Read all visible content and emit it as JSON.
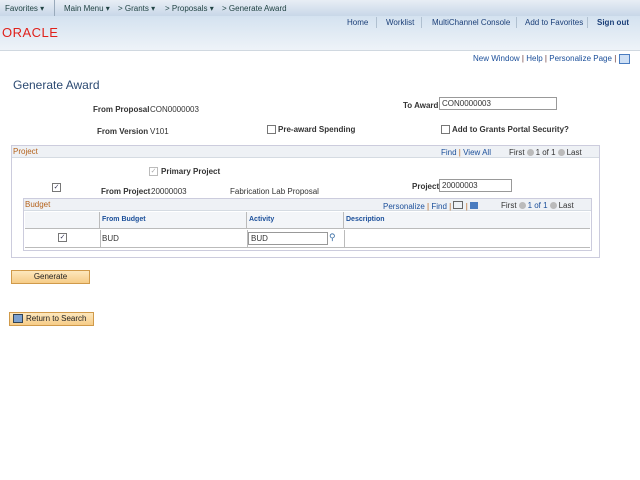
{
  "topbar": {
    "favorites": "Favorites ▾",
    "main_menu": "Main Menu ▾",
    "crumb1": "> Grants ▾",
    "crumb2": "> Proposals ▾",
    "crumb3": "> Generate Award"
  },
  "header": {
    "logo": "ORACLE",
    "links": [
      "Home",
      "Worklist",
      "MultiChannel Console",
      "Add to Favorites",
      "Sign out"
    ]
  },
  "pagebar": {
    "new_window": "New Window",
    "help": "Help",
    "personalize": "Personalize Page"
  },
  "page": {
    "title": "Generate Award",
    "from_proposal_label": "From Proposal",
    "from_proposal": "CON0000003",
    "to_award_label": "To Award",
    "to_award": "CON0000003",
    "from_version_label": "From Version",
    "from_version": "V101",
    "preaward_label": "Pre-award Spending",
    "portal_label": "Add to Grants Portal Security?"
  },
  "project": {
    "title": "Project",
    "find": "Find",
    "view_all": "View All",
    "first": "First",
    "count": "1 of 1",
    "last": "Last",
    "primary_label": "Primary Project",
    "from_project_label": "From Project",
    "from_project": "20000003",
    "project_desc": "Fabrication Lab Proposal",
    "project_label": "Project",
    "project_value": "20000003"
  },
  "budget": {
    "title": "Budget",
    "personalize": "Personalize",
    "find": "Find",
    "first": "First",
    "count": "1 of 1",
    "last": "Last",
    "columns": [
      "",
      "From Budget",
      "Activity",
      "Description"
    ],
    "rows": [
      {
        "checked": true,
        "from_budget": "BUD",
        "activity": "BUD",
        "description": ""
      }
    ]
  },
  "buttons": {
    "generate": "Generate",
    "return": "Return to Search"
  },
  "check": "✓"
}
